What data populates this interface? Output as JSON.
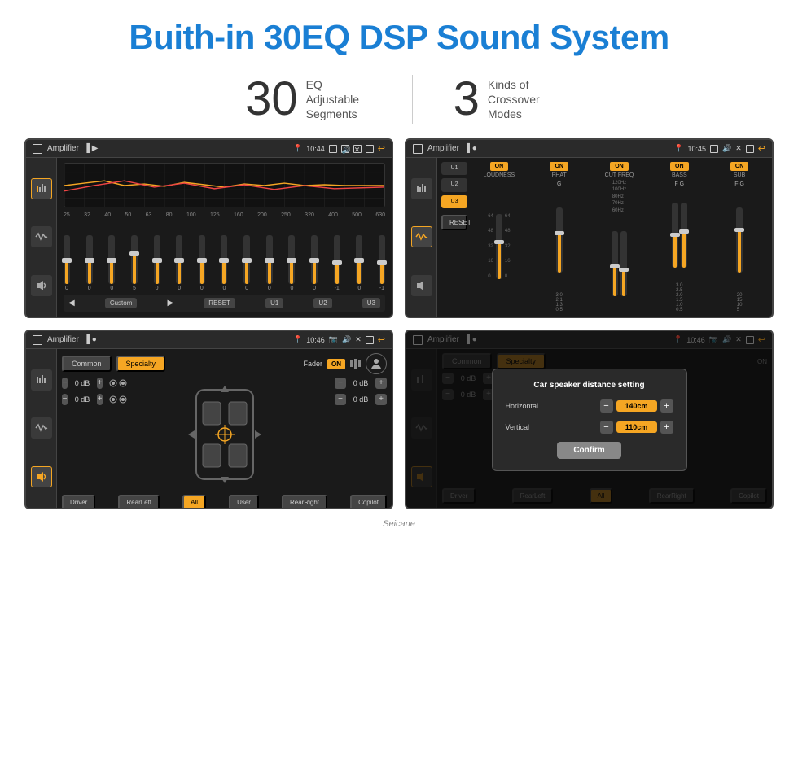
{
  "header": {
    "title": "Buith-in 30EQ DSP Sound System"
  },
  "stats": [
    {
      "number": "30",
      "label": "EQ Adjustable\nSegments"
    },
    {
      "number": "3",
      "label": "Kinds of\nCrossover Modes"
    }
  ],
  "screens": [
    {
      "id": "eq-screen",
      "topbar": {
        "app_name": "Amplifier",
        "time": "10:44"
      },
      "eq_frequencies": [
        "25",
        "32",
        "40",
        "50",
        "63",
        "80",
        "100",
        "125",
        "160",
        "200",
        "250",
        "320",
        "400",
        "500",
        "630"
      ],
      "eq_values": [
        "0",
        "0",
        "0",
        "0",
        "5",
        "0",
        "0",
        "0",
        "0",
        "0",
        "0",
        "0",
        "0",
        "-1",
        "0",
        "-1"
      ],
      "bottom_buttons": [
        "Custom",
        "RESET",
        "U1",
        "U2",
        "U3"
      ]
    },
    {
      "id": "crossover-screen",
      "topbar": {
        "app_name": "Amplifier",
        "time": "10:45"
      },
      "presets": [
        "U1",
        "U2",
        "U3"
      ],
      "bands": [
        {
          "name": "LOUDNESS",
          "toggle": "ON",
          "freq": ""
        },
        {
          "name": "PHAT",
          "toggle": "ON",
          "freq": ""
        },
        {
          "name": "CUT FREQ",
          "toggle": "ON",
          "freq": "120Hz"
        },
        {
          "name": "BASS",
          "toggle": "ON",
          "freq": "100Hz"
        },
        {
          "name": "SUB",
          "toggle": "ON",
          "freq": ""
        }
      ],
      "reset_label": "RESET"
    },
    {
      "id": "speaker-screen",
      "topbar": {
        "app_name": "Amplifier",
        "time": "10:46"
      },
      "modes": [
        "Common",
        "Specialty"
      ],
      "fader_label": "Fader",
      "fader_toggle": "ON",
      "db_controls": [
        {
          "value": "0 dB"
        },
        {
          "value": "0 dB"
        },
        {
          "value": "0 dB"
        },
        {
          "value": "0 dB"
        }
      ],
      "seat_buttons": [
        "Driver",
        "RearLeft",
        "All",
        "User",
        "RearRight",
        "Copilot"
      ]
    },
    {
      "id": "distance-screen",
      "topbar": {
        "app_name": "Amplifier",
        "time": "10:46"
      },
      "modes": [
        "Common",
        "Specialty"
      ],
      "dialog": {
        "title": "Car speaker distance setting",
        "horizontal_label": "Horizontal",
        "horizontal_value": "140cm",
        "vertical_label": "Vertical",
        "vertical_value": "110cm",
        "confirm_label": "Confirm"
      }
    }
  ],
  "watermark": "Seicane"
}
